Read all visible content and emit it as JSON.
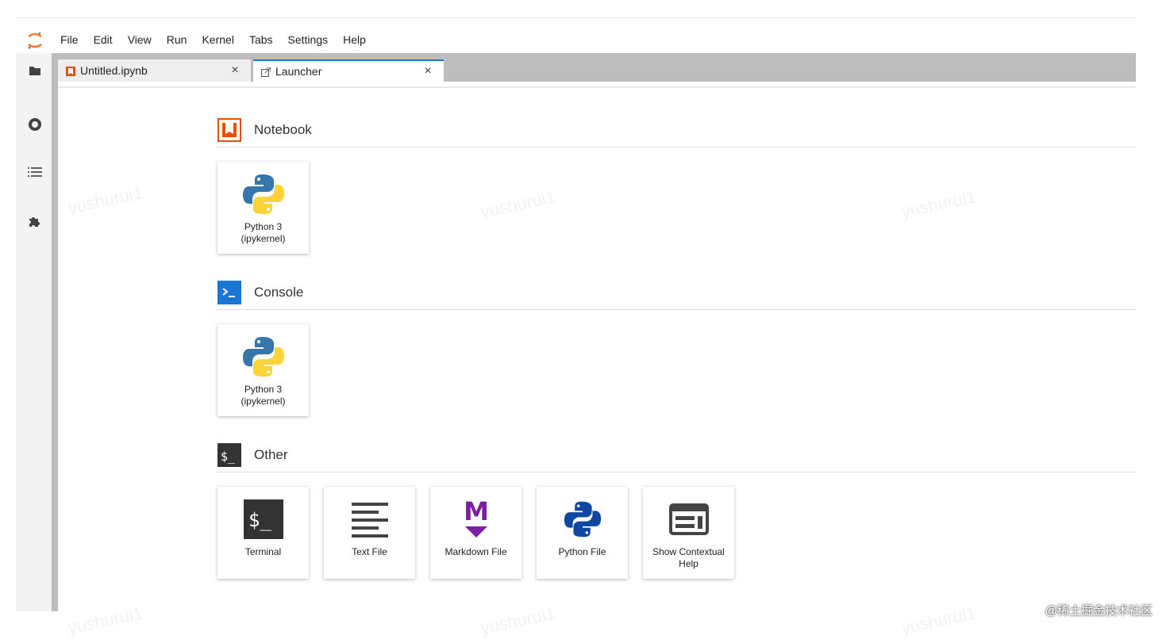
{
  "menu": [
    "File",
    "Edit",
    "View",
    "Run",
    "Kernel",
    "Tabs",
    "Settings",
    "Help"
  ],
  "tabs": [
    {
      "label": "Untitled.ipynb",
      "close": "×"
    },
    {
      "label": "Launcher",
      "close": "×"
    }
  ],
  "sections": {
    "notebook": {
      "title": "Notebook",
      "cards": [
        {
          "label": "Python 3\n(ipykernel)"
        }
      ]
    },
    "console": {
      "title": "Console",
      "cards": [
        {
          "label": "Python 3\n(ipykernel)"
        }
      ]
    },
    "other": {
      "title": "Other",
      "cards": [
        {
          "label": "Terminal"
        },
        {
          "label": "Text File"
        },
        {
          "label": "Markdown File"
        },
        {
          "label": "Python File"
        },
        {
          "label": "Show Contextual\nHelp"
        }
      ]
    }
  },
  "colors": {
    "accent": "#1976d2",
    "notebook": "#e65100",
    "console": "#1976d2",
    "markdown": "#7b1fa2"
  },
  "watermark": "yushurui1",
  "footer_tag": "@稀土掘金技术社区"
}
